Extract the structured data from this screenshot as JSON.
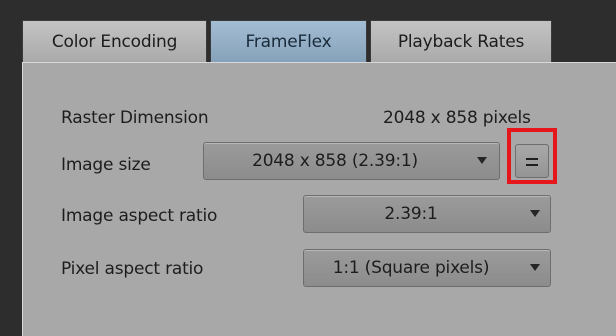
{
  "tabs": [
    {
      "label": "Color Encoding",
      "active": false
    },
    {
      "label": "FrameFlex",
      "active": true
    },
    {
      "label": "Playback Rates",
      "active": false
    }
  ],
  "raster": {
    "label": "Raster Dimension",
    "value": "2048 x 858 pixels"
  },
  "image_size": {
    "label": "Image size",
    "selected": "2048 x 858 (2.39:1)"
  },
  "image_aspect_ratio": {
    "label": "Image aspect ratio",
    "selected": "2.39:1"
  },
  "pixel_aspect_ratio": {
    "label": "Pixel aspect ratio",
    "selected": "1:1 (Square pixels)"
  },
  "icons": {
    "dropdown": "chevron-down-icon",
    "link_button": "equals-icon"
  },
  "colors": {
    "highlight": "#e5161c",
    "active_tab": "#97b1c8",
    "panel": "#a8a8a8"
  }
}
